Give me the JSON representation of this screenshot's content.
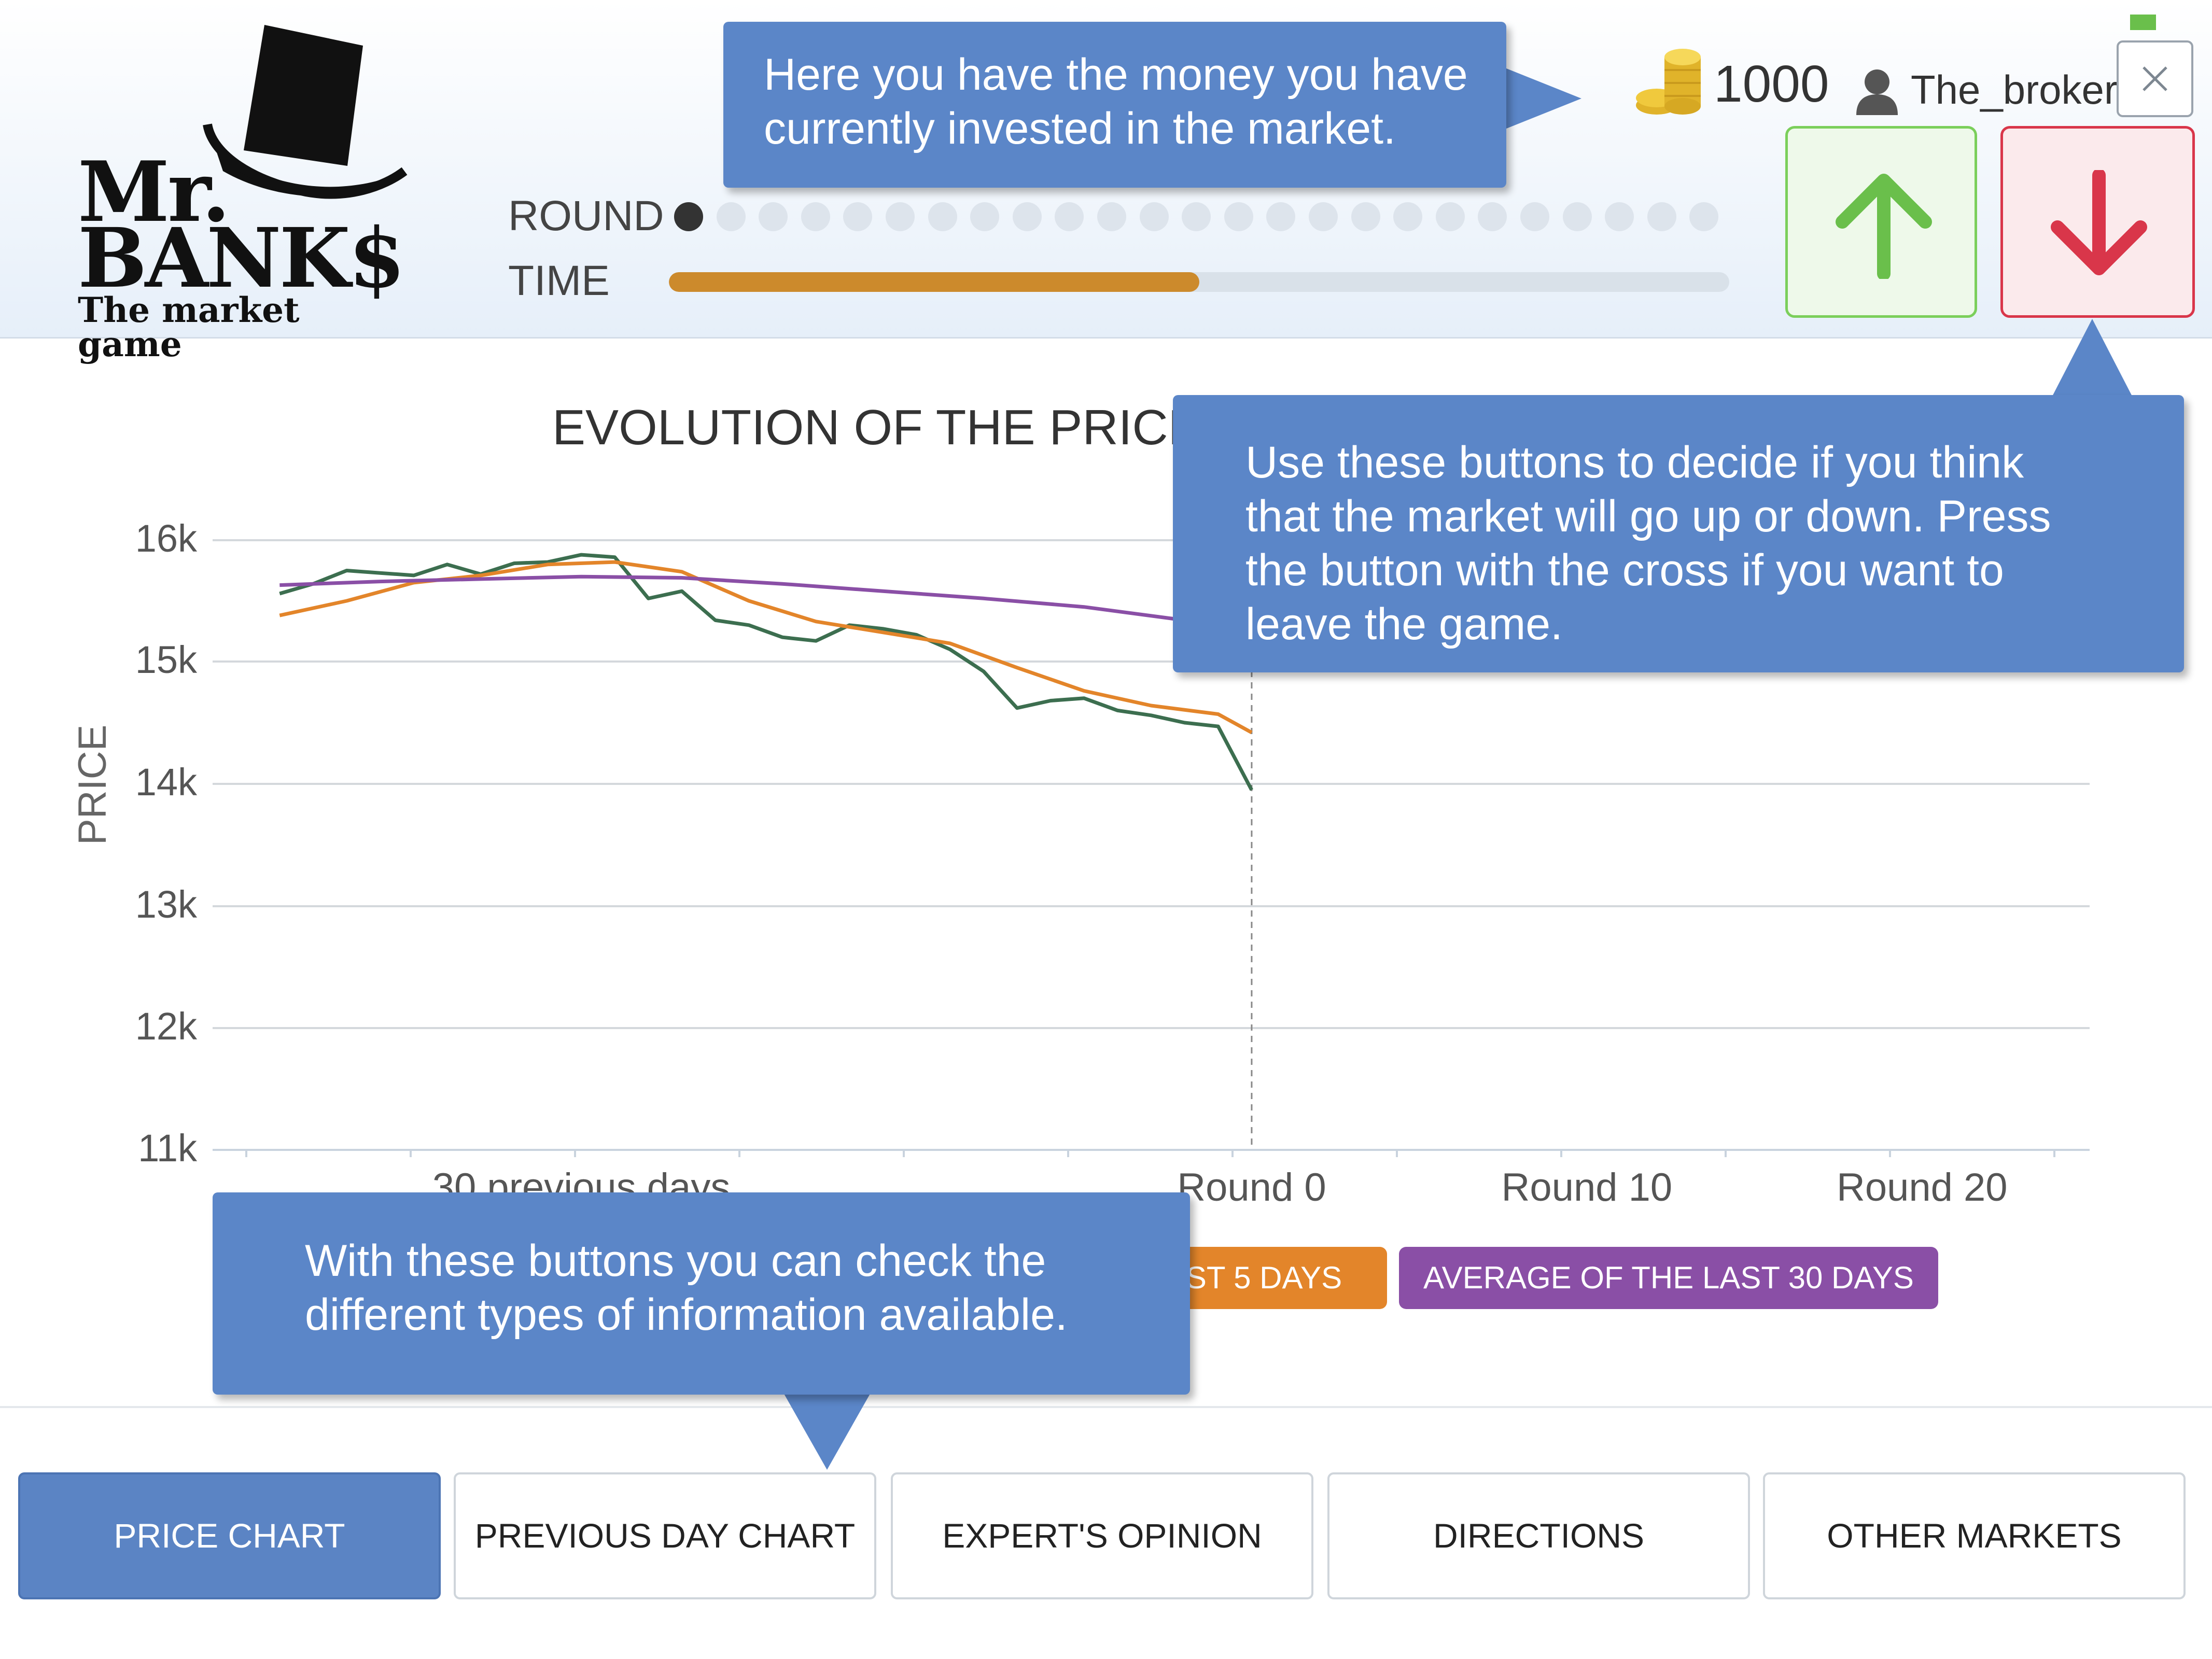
{
  "app": {
    "logo_line1": "Mr.",
    "logo_line2": "BANK$",
    "logo_tagline": "The market game"
  },
  "header": {
    "round_label": "ROUND",
    "time_label": "TIME",
    "round_current": 1,
    "round_total": 25,
    "time_progress": 0.5,
    "money": "1000",
    "username": "The_broker",
    "icons": [
      "top-hat-icon",
      "coins-icon",
      "user-icon",
      "close-icon",
      "up-arrow-icon",
      "down-arrow-icon"
    ]
  },
  "chart_data": {
    "type": "line",
    "title": "EVOLUTION OF THE PRICE",
    "xlabel": "",
    "ylabel": "PRICE",
    "y_ticks": [
      "16k",
      "15k",
      "14k",
      "13k",
      "12k",
      "11k"
    ],
    "ylim": [
      11000,
      16000
    ],
    "x_tick_labels": [
      {
        "label": "30 previous days",
        "x": -20
      },
      {
        "label": "Round 0",
        "x": 0
      },
      {
        "label": "Round 10",
        "x": 10
      },
      {
        "label": "Round 20",
        "x": 20
      }
    ],
    "xlim": [
      -31,
      25
    ],
    "grid": true,
    "series": [
      {
        "key": "price",
        "color": "#3c6e4f",
        "x": [
          -29,
          -28,
          -27,
          -26,
          -25,
          -24,
          -23,
          -22,
          -21,
          -20,
          -19,
          -18,
          -17,
          -16,
          -15,
          -14,
          -13,
          -12,
          -11,
          -10,
          -9,
          -8,
          -7,
          -6,
          -5,
          -4,
          -3,
          -2,
          -1,
          0
        ],
        "y": [
          15560,
          15640,
          15750,
          15730,
          15710,
          15800,
          15720,
          15810,
          15820,
          15880,
          15860,
          15520,
          15580,
          15340,
          15300,
          15200,
          15170,
          15300,
          15270,
          15220,
          15100,
          14920,
          14620,
          14680,
          14700,
          14600,
          14560,
          14500,
          14470,
          13950
        ]
      },
      {
        "key": "avg5",
        "color": "#e3852a",
        "x": [
          -29,
          -27,
          -25,
          -23,
          -21,
          -19,
          -17,
          -15,
          -13,
          -11,
          -9,
          -7,
          -5,
          -3,
          -1,
          0
        ],
        "y": [
          15380,
          15500,
          15650,
          15710,
          15800,
          15820,
          15740,
          15500,
          15330,
          15240,
          15150,
          14950,
          14760,
          14640,
          14570,
          14420
        ]
      },
      {
        "key": "avg30",
        "color": "#8a4fa6",
        "x": [
          -29,
          -26,
          -23,
          -20,
          -17,
          -14,
          -11,
          -8,
          -5,
          -2
        ],
        "y": [
          15630,
          15660,
          15680,
          15700,
          15690,
          15640,
          15580,
          15520,
          15450,
          15340
        ]
      }
    ],
    "vline_x": 0
  },
  "legend_buttons": {
    "avg5_label": "ST 5 DAYS",
    "avg30_label": "AVERAGE OF THE LAST 30 DAYS",
    "avg5_color": "#e3852a",
    "avg30_color": "#8a4fa6"
  },
  "tabs": [
    {
      "label": "PRICE CHART",
      "active": true
    },
    {
      "label": "PREVIOUS DAY CHART",
      "active": false
    },
    {
      "label": "EXPERT'S OPINION",
      "active": false
    },
    {
      "label": "DIRECTIONS",
      "active": false
    },
    {
      "label": "OTHER MARKETS",
      "active": false
    }
  ],
  "tooltips": {
    "money": [
      "Here you have the money you have",
      "currently invested in the market."
    ],
    "buttons": [
      "Use these buttons to decide if you think",
      "that the market will go up or down. Press",
      "the button with the cross if you want to",
      "leave the game."
    ],
    "info": [
      "With these buttons you can check the",
      "different types of information available."
    ]
  },
  "colors": {
    "accent": "#5b84c4",
    "tooltip": "#5b86c8",
    "up": "#6abf4b",
    "down": "#d9364a",
    "time_bar": "#cc8a2c"
  }
}
